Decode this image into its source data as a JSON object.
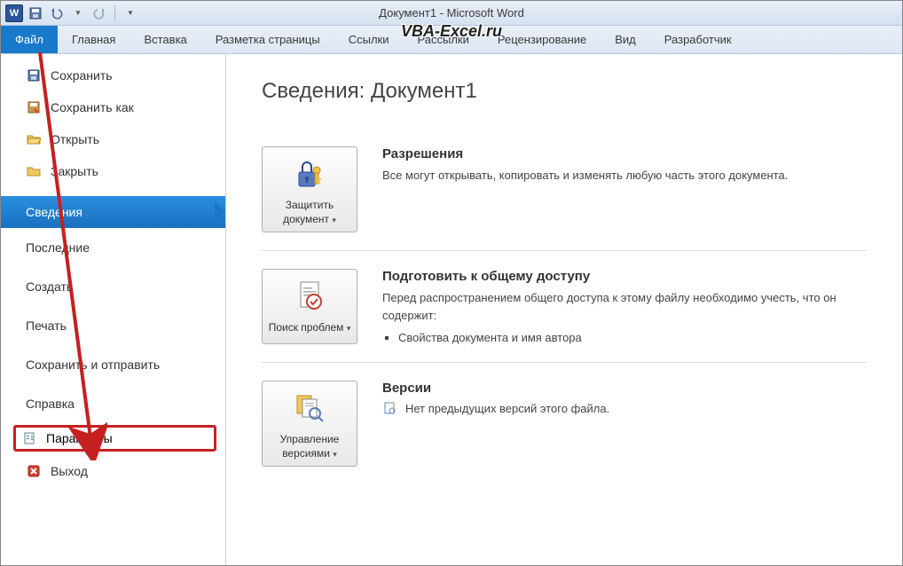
{
  "title_bar": {
    "document": "Документ1",
    "app": "Microsoft Word"
  },
  "watermark": "VBA-Excel.ru",
  "qat": {
    "save": "save-icon",
    "undo": "undo-icon",
    "redo": "redo-icon"
  },
  "ribbon": {
    "file": "Файл",
    "tabs": [
      "Главная",
      "Вставка",
      "Разметка страницы",
      "Ссылки",
      "Рассылки",
      "Рецензирование",
      "Вид",
      "Разработчик"
    ]
  },
  "side": {
    "items_top": [
      {
        "icon": "save",
        "label": "Сохранить"
      },
      {
        "icon": "saveas",
        "label": "Сохранить как"
      },
      {
        "icon": "open",
        "label": "Открыть"
      },
      {
        "icon": "close",
        "label": "Закрыть"
      }
    ],
    "selected": "Сведения",
    "sections": [
      "Последние",
      "Создать",
      "Печать",
      "Сохранить и отправить",
      "Справка"
    ],
    "options": "Параметры",
    "exit": "Выход"
  },
  "page": {
    "title_prefix": "Сведения: ",
    "title_doc": "Документ1"
  },
  "blocks": {
    "permissions": {
      "btn": "Защитить документ",
      "heading": "Разрешения",
      "text": "Все могут открывать, копировать и изменять любую часть этого документа."
    },
    "prepare": {
      "btn": "Поиск проблем",
      "heading": "Подготовить к общему доступу",
      "text": "Перед распространением общего доступа к этому файлу необходимо учесть, что он содержит:",
      "bullets": [
        "Свойства документа и имя автора"
      ]
    },
    "versions": {
      "btn": "Управление версиями",
      "heading": "Версии",
      "text": "Нет предыдущих версий этого файла."
    }
  }
}
